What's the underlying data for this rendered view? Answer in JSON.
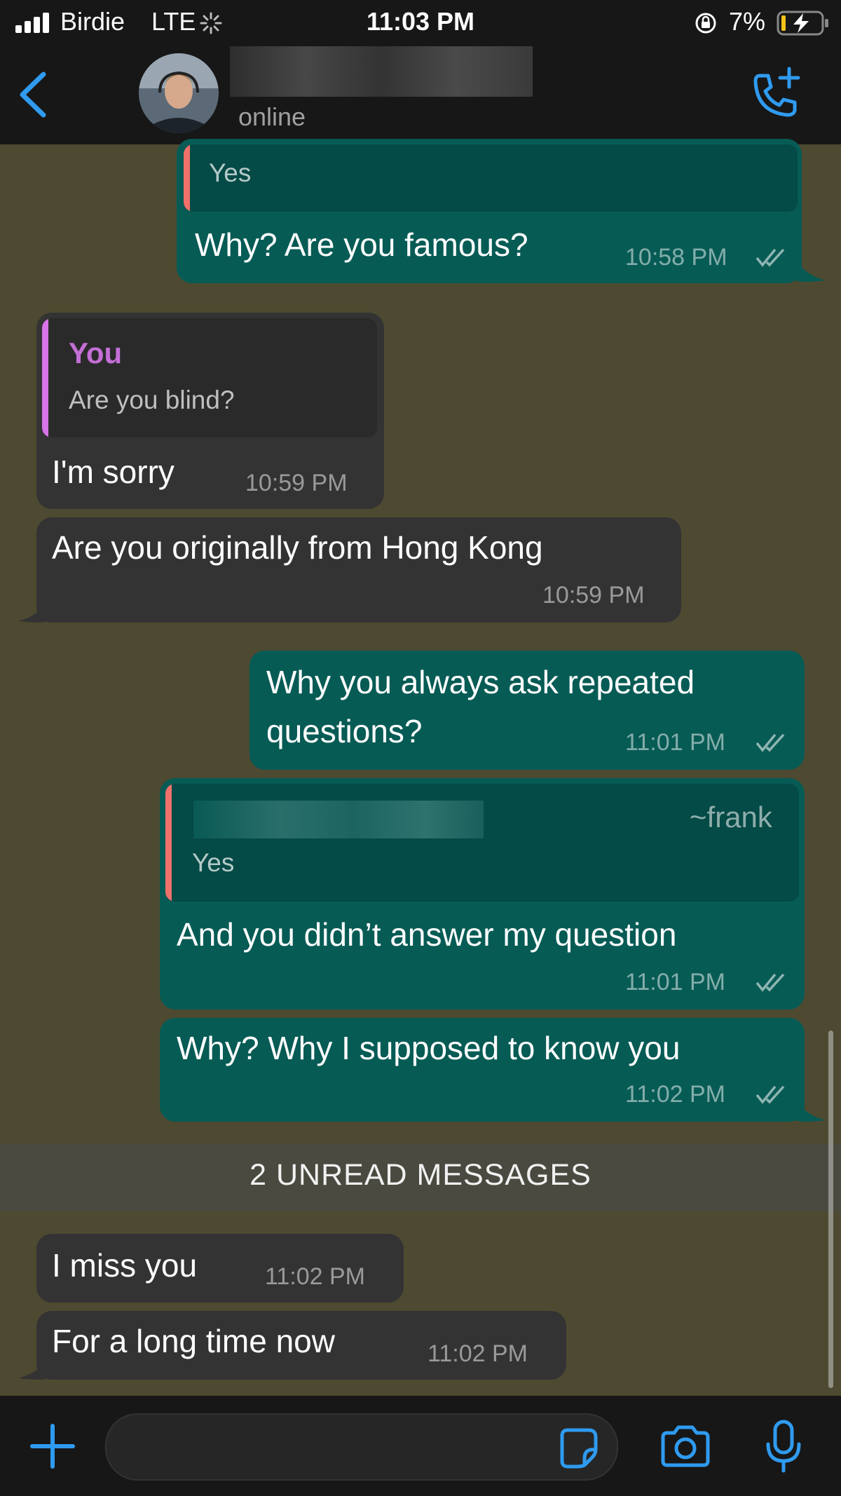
{
  "status_bar": {
    "carrier": "Birdie",
    "network": "LTE",
    "time": "11:03 PM",
    "battery": "7%"
  },
  "header": {
    "contact_status": "online"
  },
  "messages": {
    "m1": {
      "quote_text": "Yes",
      "text": "Why? Are you famous?",
      "time": "10:58 PM"
    },
    "m2": {
      "quote_name": "You",
      "quote_text": "Are you blind?",
      "text": "I'm sorry",
      "time": "10:59 PM"
    },
    "m3": {
      "text": "Are you originally from Hong Kong",
      "time": "10:59 PM"
    },
    "m4": {
      "text_line1": "Why you always ask repeated",
      "text_line2": "questions?",
      "time": "11:01 PM"
    },
    "m5": {
      "quote_tag": "~frank",
      "quote_text": "Yes",
      "text": "And you didn’t answer my question",
      "time": "11:01 PM"
    },
    "m6": {
      "text": "Why? Why I supposed to know you",
      "time": "11:02 PM"
    },
    "unread": "2 UNREAD MESSAGES",
    "m7": {
      "text": "I miss you",
      "time": "11:02 PM"
    },
    "m8": {
      "text": "For a long time now",
      "time": "11:02 PM"
    }
  },
  "colors": {
    "accent": "#2f9bf0",
    "outgoing_bubble": "#075b55",
    "incoming_bubble": "#333334",
    "quote_bar_outgoing": "#f0706a",
    "quote_bar_incoming": "#d674e8",
    "quote_name": "#c46fd6"
  },
  "icons": [
    "back-chevron-icon",
    "add-call-icon",
    "plus-icon",
    "sticker-icon",
    "camera-icon",
    "microphone-icon",
    "read-ticks-icon"
  ]
}
